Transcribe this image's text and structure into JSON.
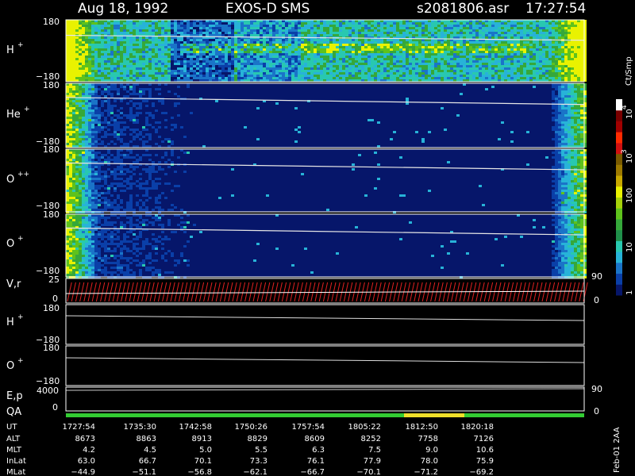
{
  "header": {
    "date": "Aug 18, 1992",
    "instrument": "EXOS-D SMS",
    "file": "s2081806.asr",
    "time": "17:27:54"
  },
  "footer_note": "Feb-01 2AA",
  "colorbar": {
    "unit": "Ct/Smp",
    "labels": [
      "1",
      "10",
      "100",
      "10",
      "10"
    ],
    "exponents": [
      "",
      "",
      "",
      "3",
      "4"
    ],
    "colors": [
      "#06166a",
      "#0a3fa8",
      "#1a74c8",
      "#27b3d8",
      "#28c8b0",
      "#1f8f4a",
      "#35a83a",
      "#5ec21c",
      "#a6d20a",
      "#e9f200",
      "#c7a800",
      "#9d7a00",
      "#7a5b00",
      "#d01010",
      "#ff2a00",
      "#a00000",
      "#7a0000",
      "#ffffff"
    ]
  },
  "chart_data": {
    "type": "heatmap",
    "panels": [
      {
        "name": "H",
        "sup": "+",
        "ylim": [
          -180,
          180
        ],
        "yticks": [
          "180",
          "−180"
        ]
      },
      {
        "name": "He",
        "sup": "+",
        "ylim": [
          -180,
          180
        ],
        "yticks": [
          "180",
          "−180"
        ]
      },
      {
        "name": "O",
        "sup": "++",
        "ylim": [
          -180,
          180
        ],
        "yticks": [
          "180",
          "−180"
        ]
      },
      {
        "name": "O",
        "sup": "+",
        "ylim": [
          -180,
          180
        ],
        "yticks": [
          "180",
          "−180"
        ]
      },
      {
        "name": "V,r",
        "sup": "",
        "left_ticks": [
          "25",
          "0"
        ],
        "right_ticks": [
          "90",
          "0"
        ]
      },
      {
        "name": "H",
        "sup": "+",
        "ylim": [
          -180,
          180
        ],
        "yticks": [
          "180",
          "−180"
        ]
      },
      {
        "name": "O",
        "sup": "+",
        "ylim": [
          -180,
          180
        ],
        "yticks": [
          "180",
          "−180"
        ]
      },
      {
        "name": "E,p",
        "sup": "",
        "left_ticks": [
          "4000",
          "0"
        ],
        "right_ticks": [
          "90",
          "0"
        ]
      },
      {
        "name": "QA",
        "sup": "",
        "left_ticks": [],
        "right_ticks": []
      }
    ],
    "table": {
      "row_labels": [
        "UT",
        "ALT",
        "MLT",
        "InLat",
        "MLat"
      ],
      "columns": [
        [
          "1727:54",
          "8673",
          "4.2",
          "63.0",
          "−44.9"
        ],
        [
          "1735:30",
          "8863",
          "4.5",
          "66.7",
          "−51.1"
        ],
        [
          "1742:58",
          "8913",
          "5.0",
          "70.1",
          "−56.8"
        ],
        [
          "1750:26",
          "8829",
          "5.5",
          "73.3",
          "−62.1"
        ],
        [
          "1757:54",
          "8609",
          "6.3",
          "76.1",
          "−66.7"
        ],
        [
          "1805:22",
          "8252",
          "7.5",
          "77.9",
          "−70.1"
        ],
        [
          "1812:50",
          "7758",
          "9.0",
          "78.0",
          "−71.2"
        ],
        [
          "1820:18",
          "7126",
          "10.6",
          "75.9",
          "−69.2"
        ]
      ]
    }
  }
}
